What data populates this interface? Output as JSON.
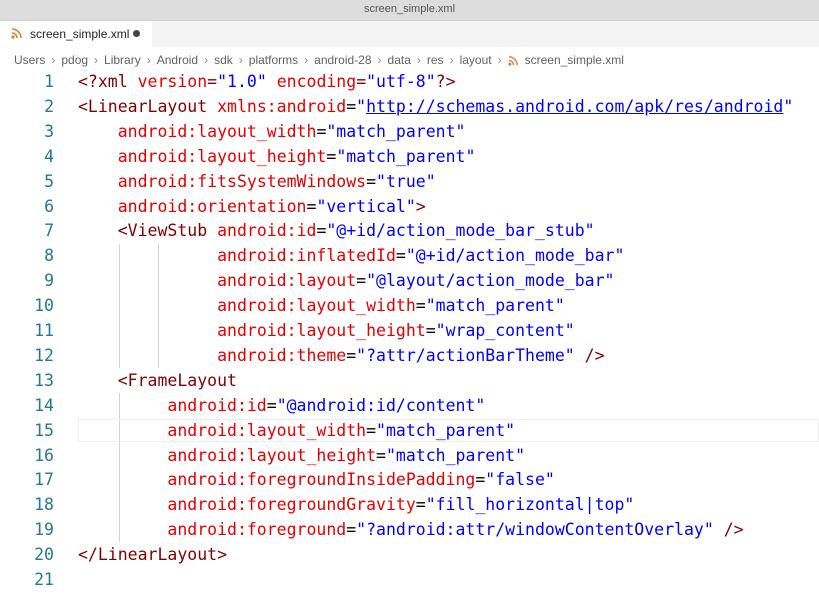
{
  "window": {
    "title": "screen_simple.xml"
  },
  "tab": {
    "label": "screen_simple.xml"
  },
  "breadcrumb": [
    "Users",
    "pdog",
    "Library",
    "Android",
    "sdk",
    "platforms",
    "android-28",
    "data",
    "res",
    "layout",
    "screen_simple.xml"
  ],
  "colors": {
    "line_number": "#237893",
    "tag": "#800000",
    "attribute": "#e50000",
    "string": "#0000ff",
    "rss_icon": "#e37933"
  },
  "lines": [
    {
      "n": "1",
      "t": [
        [
          "pi",
          "<?xml "
        ],
        [
          "at",
          "version"
        ],
        [
          "",
          ""
        ],
        [
          "pi",
          "="
        ],
        [
          "st",
          "\"1.0\""
        ],
        [
          "",
          ""
        ],
        [
          "pi",
          " "
        ],
        [
          "at",
          "encoding"
        ],
        [
          "pi",
          "="
        ],
        [
          "st",
          "\"utf-8\""
        ],
        [
          "pi",
          "?>"
        ]
      ]
    },
    {
      "n": "2",
      "t": [
        [
          "tg",
          "<LinearLayout "
        ],
        [
          "at",
          "xmlns:android"
        ],
        [
          "",
          "="
        ],
        [
          "st",
          "\""
        ],
        [
          "lk",
          "http://schemas.android.com/apk/res/android"
        ],
        [
          "st",
          "\""
        ]
      ]
    },
    {
      "n": "3",
      "t": [
        [
          "",
          "    "
        ],
        [
          "at",
          "android:layout_width"
        ],
        [
          "",
          "="
        ],
        [
          "st",
          "\"match_parent\""
        ]
      ]
    },
    {
      "n": "4",
      "t": [
        [
          "",
          "    "
        ],
        [
          "at",
          "android:layout_height"
        ],
        [
          "",
          "="
        ],
        [
          "st",
          "\"match_parent\""
        ]
      ]
    },
    {
      "n": "5",
      "t": [
        [
          "",
          "    "
        ],
        [
          "at",
          "android:fitsSystemWindows"
        ],
        [
          "",
          "="
        ],
        [
          "st",
          "\"true\""
        ]
      ]
    },
    {
      "n": "6",
      "t": [
        [
          "",
          "    "
        ],
        [
          "at",
          "android:orientation"
        ],
        [
          "",
          "="
        ],
        [
          "st",
          "\"vertical\""
        ],
        [
          "tg",
          ">"
        ]
      ]
    },
    {
      "n": "7",
      "t": [
        [
          "",
          "    "
        ],
        [
          "tg",
          "<ViewStub "
        ],
        [
          "at",
          "android:id"
        ],
        [
          "",
          "="
        ],
        [
          "st",
          "\"@+id/action_mode_bar_stub\""
        ]
      ]
    },
    {
      "n": "8",
      "t": [
        [
          "",
          "              "
        ],
        [
          "at",
          "android:inflatedId"
        ],
        [
          "",
          "="
        ],
        [
          "st",
          "\"@+id/action_mode_bar\""
        ]
      ]
    },
    {
      "n": "9",
      "t": [
        [
          "",
          "              "
        ],
        [
          "at",
          "android:layout"
        ],
        [
          "",
          "="
        ],
        [
          "st",
          "\"@layout/action_mode_bar\""
        ]
      ]
    },
    {
      "n": "10",
      "t": [
        [
          "",
          "              "
        ],
        [
          "at",
          "android:layout_width"
        ],
        [
          "",
          "="
        ],
        [
          "st",
          "\"match_parent\""
        ]
      ]
    },
    {
      "n": "11",
      "t": [
        [
          "",
          "              "
        ],
        [
          "at",
          "android:layout_height"
        ],
        [
          "",
          "="
        ],
        [
          "st",
          "\"wrap_content\""
        ]
      ]
    },
    {
      "n": "12",
      "t": [
        [
          "",
          "              "
        ],
        [
          "at",
          "android:theme"
        ],
        [
          "",
          "="
        ],
        [
          "st",
          "\"?attr/actionBarTheme\""
        ],
        [
          "tg",
          " />"
        ]
      ]
    },
    {
      "n": "13",
      "t": [
        [
          "",
          "    "
        ],
        [
          "tg",
          "<FrameLayout"
        ]
      ]
    },
    {
      "n": "14",
      "t": [
        [
          "",
          "         "
        ],
        [
          "at",
          "android:id"
        ],
        [
          "",
          "="
        ],
        [
          "st",
          "\"@android:id/content\""
        ]
      ]
    },
    {
      "n": "15",
      "t": [
        [
          "",
          "         "
        ],
        [
          "at",
          "android:layout_width"
        ],
        [
          "",
          "="
        ],
        [
          "st",
          "\"match_parent\""
        ]
      ]
    },
    {
      "n": "16",
      "t": [
        [
          "",
          "         "
        ],
        [
          "at",
          "android:layout_height"
        ],
        [
          "",
          "="
        ],
        [
          "st",
          "\"match_parent\""
        ]
      ]
    },
    {
      "n": "17",
      "t": [
        [
          "",
          "         "
        ],
        [
          "at",
          "android:foregroundInsidePadding"
        ],
        [
          "",
          "="
        ],
        [
          "st",
          "\"false\""
        ]
      ]
    },
    {
      "n": "18",
      "t": [
        [
          "",
          "         "
        ],
        [
          "at",
          "android:foregroundGravity"
        ],
        [
          "",
          "="
        ],
        [
          "st",
          "\"fill_horizontal|top\""
        ]
      ]
    },
    {
      "n": "19",
      "t": [
        [
          "",
          "         "
        ],
        [
          "at",
          "android:foreground"
        ],
        [
          "",
          "="
        ],
        [
          "st",
          "\"?android:attr/windowContentOverlay\""
        ],
        [
          "tg",
          " />"
        ]
      ]
    },
    {
      "n": "20",
      "t": [
        [
          "tg",
          "</LinearLayout>"
        ]
      ]
    },
    {
      "n": "21",
      "t": []
    }
  ]
}
